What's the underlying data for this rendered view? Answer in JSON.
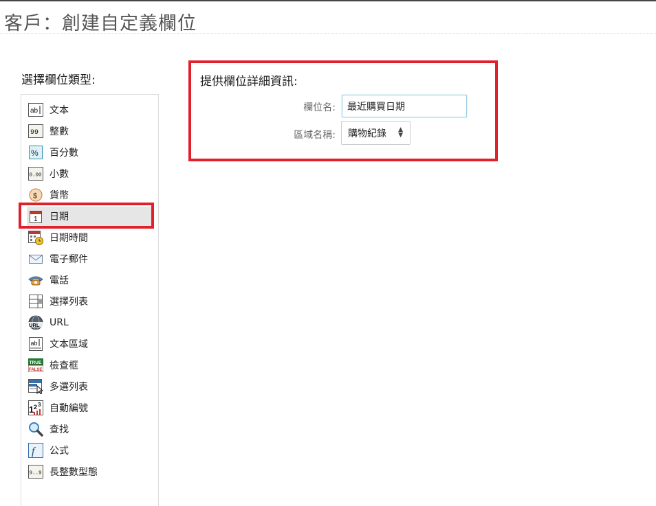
{
  "page": {
    "title": "客戶：創建自定義欄位"
  },
  "field_types": {
    "heading": "選擇欄位類型:",
    "selected": "日期",
    "items": [
      {
        "label": "文本",
        "icon": "text-field-icon"
      },
      {
        "label": "整數",
        "icon": "integer-icon"
      },
      {
        "label": "百分數",
        "icon": "percent-icon"
      },
      {
        "label": "小數",
        "icon": "decimal-icon"
      },
      {
        "label": "貨幣",
        "icon": "currency-icon"
      },
      {
        "label": "日期",
        "icon": "calendar-icon"
      },
      {
        "label": "日期時間",
        "icon": "calendar-clock-icon"
      },
      {
        "label": "電子郵件",
        "icon": "envelope-icon"
      },
      {
        "label": "電話",
        "icon": "telephone-icon"
      },
      {
        "label": "選擇列表",
        "icon": "picklist-icon"
      },
      {
        "label": "URL",
        "icon": "globe-url-icon"
      },
      {
        "label": "文本區域",
        "icon": "text-area-icon"
      },
      {
        "label": "檢查框",
        "icon": "true-false-icon"
      },
      {
        "label": "多選列表",
        "icon": "multi-picklist-icon"
      },
      {
        "label": "自動編號",
        "icon": "auto-number-icon"
      },
      {
        "label": "查找",
        "icon": "magnifier-icon"
      },
      {
        "label": "公式",
        "icon": "formula-icon"
      },
      {
        "label": "長整數型態",
        "icon": "long-integer-icon"
      }
    ]
  },
  "details": {
    "heading": "提供欄位詳細資訊:",
    "field_name_label": "欄位名:",
    "field_name_value": "最近購買日期",
    "area_label": "區域名稱:",
    "area_value": "購物紀錄"
  },
  "colors": {
    "highlight": "#e0202b",
    "selected_bg": "#e6e6e6",
    "input_border": "#9ccde6"
  }
}
